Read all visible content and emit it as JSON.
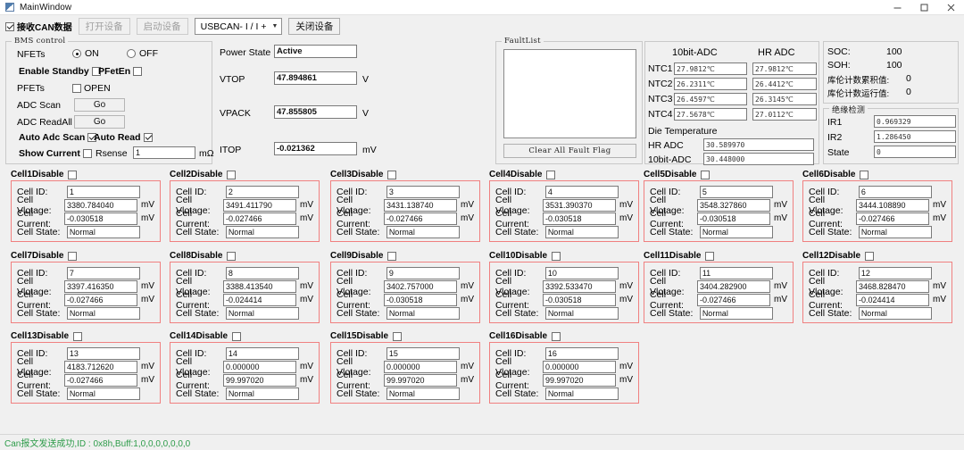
{
  "window": {
    "title": "MainWindow",
    "minimize_label": "–",
    "maximize_label": "□",
    "close_label": "✕",
    "icon_name": "app-icon"
  },
  "toolbar": {
    "receive_can_checkbox": {
      "label": "接收CAN数据",
      "checked": true
    },
    "open_device_button": "打开设备",
    "start_device_button": "启动设备",
    "device_select": {
      "value": "USBCAN- I / I +",
      "caret": "⌄"
    },
    "close_device_button": "关闭设备"
  },
  "bms_control": {
    "legend": "BMS control",
    "nfets_label": "NFETs",
    "nfets_on": "ON",
    "nfets_off": "OFF",
    "nfets_selected": "ON",
    "enable_standby_label": "Enable Standby",
    "enable_standby_checked": false,
    "pfeten_label": "PFetEn",
    "pfeten_checked": false,
    "pfets_label": "PFETs",
    "pfets_open_label": "OPEN",
    "pfets_open_checked": false,
    "adc_scan_label": "ADC Scan",
    "adc_scan_button": "Go",
    "adc_readall_label": "ADC ReadAll",
    "adc_readall_button": "Go",
    "auto_adc_scan_label": "Auto Adc Scan",
    "auto_adc_scan_checked": true,
    "auto_read_label": "Auto Read",
    "auto_read_checked": true,
    "show_current_label": "Show Current",
    "show_current_checked": false,
    "rsense_label": "Rsense",
    "rsense_value": "1",
    "rsense_unit": "mΩ"
  },
  "measurements": {
    "power_state_label": "Power State",
    "power_state_value": "Active",
    "vtop_label": "VTOP",
    "vtop_value": "47.894861",
    "vtop_unit": "V",
    "vpack_label": "VPACK",
    "vpack_value": "47.855805",
    "vpack_unit": "V",
    "itop_label": "ITOP",
    "itop_value": "-0.021362",
    "itop_unit": "mV"
  },
  "fault_list": {
    "legend": "FaultList",
    "entries": "",
    "clear_button": "Clear All Fault Flag"
  },
  "adc_panel": {
    "col_10bit": "10bit-ADC",
    "col_hr": "HR ADC",
    "rows": [
      {
        "label": "NTC1",
        "adc10": "27.9812℃",
        "hr": "27.9812℃"
      },
      {
        "label": "NTC2",
        "adc10": "26.2311℃",
        "hr": "26.4412℃"
      },
      {
        "label": "NTC3",
        "adc10": "26.4597℃",
        "hr": "26.3145℃"
      },
      {
        "label": "NTC4",
        "adc10": "27.5678℃",
        "hr": "27.0112℃"
      }
    ],
    "die_temperature_label": "Die Temperature",
    "die_hr_label": "HR ADC",
    "die_hr_value": "30.589970",
    "die_10bit_label": "10bit-ADC",
    "die_10bit_value": "30.448000"
  },
  "soc_panel": {
    "soc_label": "SOC:",
    "soc_value": "100",
    "soh_label": "SOH:",
    "soh_value": "100",
    "coulomb_accum_label": "库伦计数累积值:",
    "coulomb_accum_value": "0",
    "coulomb_run_label": "库伦计数运行值:",
    "coulomb_run_value": "0"
  },
  "insulation_panel": {
    "legend": "绝缘检测",
    "ir1_label": "IR1",
    "ir1_value": "0.969329",
    "ir2_label": "IR2",
    "ir2_value": "1.286450",
    "state_label": "State",
    "state_value": "0"
  },
  "cell_labels": {
    "id": "Cell ID:",
    "voltage": "Cell Vlotage:",
    "current": "Cell Current:",
    "state": "Cell State:",
    "unit_mv": "mV"
  },
  "cells": [
    {
      "disable_label": "Cell1Disable",
      "disabled": false,
      "id": "1",
      "voltage": "3380.784040",
      "current": "-0.030518",
      "state": "Normal"
    },
    {
      "disable_label": "Cell2Disable",
      "disabled": false,
      "id": "2",
      "voltage": "3491.411790",
      "current": "-0.027466",
      "state": "Normal"
    },
    {
      "disable_label": "Cell3Disable",
      "disabled": false,
      "id": "3",
      "voltage": "3431.138740",
      "current": "-0.027466",
      "state": "Normal"
    },
    {
      "disable_label": "Cell4Disable",
      "disabled": false,
      "id": "4",
      "voltage": "3531.390370",
      "current": "-0.030518",
      "state": "Normal"
    },
    {
      "disable_label": "Cell5Disable",
      "disabled": false,
      "id": "5",
      "voltage": "3548.327860",
      "current": "-0.030518",
      "state": "Normal"
    },
    {
      "disable_label": "Cell6Disable",
      "disabled": false,
      "id": "6",
      "voltage": "3444.108890",
      "current": "-0.027466",
      "state": "Normal"
    },
    {
      "disable_label": "Cell7Disable",
      "disabled": false,
      "id": "7",
      "voltage": "3397.416350",
      "current": "-0.027466",
      "state": "Normal"
    },
    {
      "disable_label": "Cell8Disable",
      "disabled": false,
      "id": "8",
      "voltage": "3388.413540",
      "current": "-0.024414",
      "state": "Normal"
    },
    {
      "disable_label": "Cell9Disable",
      "disabled": false,
      "id": "9",
      "voltage": "3402.757000",
      "current": "-0.030518",
      "state": "Normal"
    },
    {
      "disable_label": "Cell10Disable",
      "disabled": false,
      "id": "10",
      "voltage": "3392.533470",
      "current": "-0.030518",
      "state": "Normal"
    },
    {
      "disable_label": "Cell11Disable",
      "disabled": false,
      "id": "11",
      "voltage": "3404.282900",
      "current": "-0.027466",
      "state": "Normal"
    },
    {
      "disable_label": "Cell12Disable",
      "disabled": false,
      "id": "12",
      "voltage": "3468.828470",
      "current": "-0.024414",
      "state": "Normal"
    },
    {
      "disable_label": "Cell13Disable",
      "disabled": false,
      "id": "13",
      "voltage": "4183.712620",
      "current": "-0.027466",
      "state": "Normal"
    },
    {
      "disable_label": "Cell14Disable",
      "disabled": false,
      "id": "14",
      "voltage": "0.000000",
      "current": "99.997020",
      "state": "Normal"
    },
    {
      "disable_label": "Cell15Disable",
      "disabled": false,
      "id": "15",
      "voltage": "0.000000",
      "current": "99.997020",
      "state": "Normal"
    },
    {
      "disable_label": "Cell16Disable",
      "disabled": false,
      "id": "16",
      "voltage": "0.000000",
      "current": "99.997020",
      "state": "Normal"
    }
  ],
  "status_bar": {
    "message": "Can报文发送成功,ID : 0x8h,Buff:1,0,0,0,0,0,0,0",
    "color": "#2e9c4a"
  }
}
